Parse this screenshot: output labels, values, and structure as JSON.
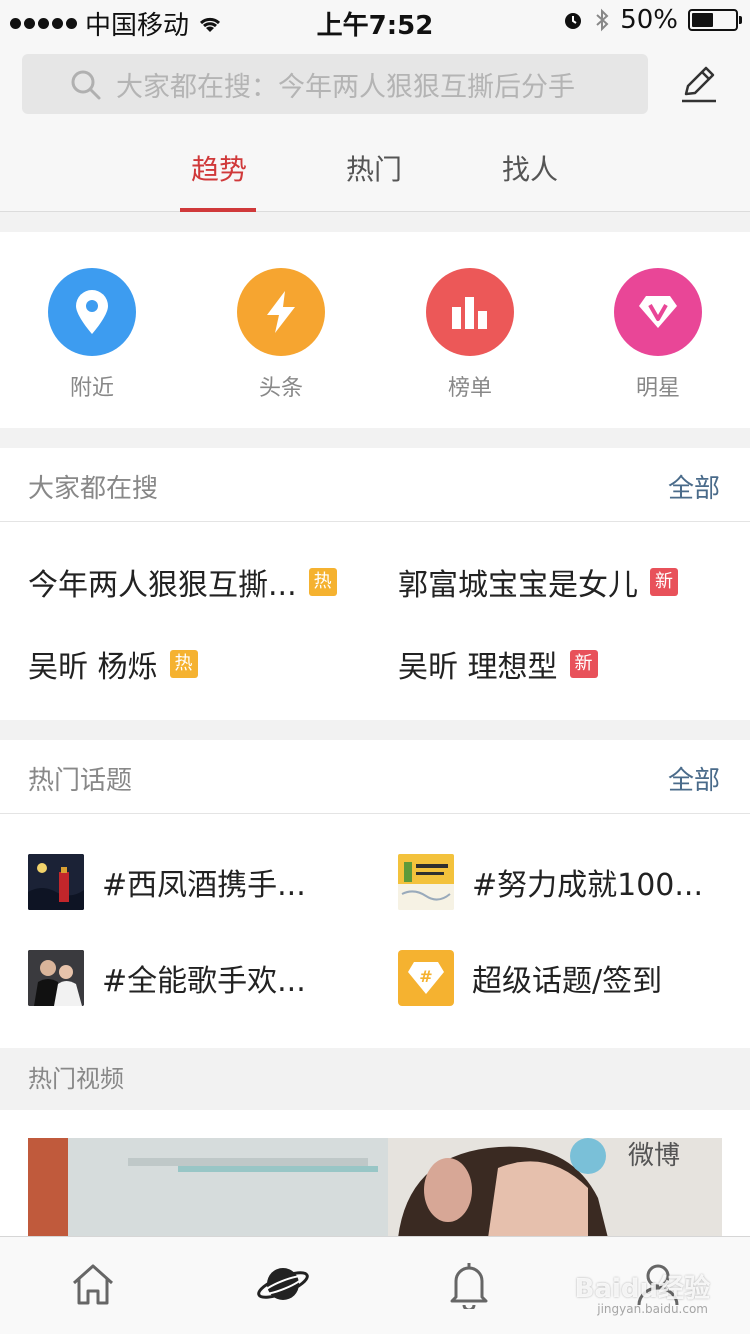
{
  "status_bar": {
    "carrier": "中国移动",
    "time": "上午7:52",
    "battery": "50%",
    "battery_level": 0.5
  },
  "search": {
    "placeholder": "大家都在搜：今年两人狠狠互撕后分手"
  },
  "tabs": [
    {
      "label": "趋势",
      "active": true
    },
    {
      "label": "热门",
      "active": false
    },
    {
      "label": "找人",
      "active": false
    }
  ],
  "quick_links": [
    {
      "label": "附近",
      "icon": "location-pin-icon",
      "color": "#3d9cf0"
    },
    {
      "label": "头条",
      "icon": "lightning-icon",
      "color": "#f6a530"
    },
    {
      "label": "榜单",
      "icon": "bar-chart-icon",
      "color": "#ec5858"
    },
    {
      "label": "明星",
      "icon": "diamond-v-icon",
      "color": "#e94697"
    }
  ],
  "trending_search": {
    "title": "大家都在搜",
    "all_label": "全部",
    "items": [
      {
        "text": "今年两人狠狠互撕...",
        "tag": "热",
        "tag_type": "hot"
      },
      {
        "text": "郭富城宝宝是女儿",
        "tag": "新",
        "tag_type": "new"
      },
      {
        "text": "吴昕 杨烁",
        "tag": "热",
        "tag_type": "hot"
      },
      {
        "text": "吴昕 理想型",
        "tag": "新",
        "tag_type": "new"
      }
    ]
  },
  "hot_topics": {
    "title": "热门话题",
    "all_label": "全部",
    "items": [
      {
        "text": "#西凤酒携手..."
      },
      {
        "text": "#努力成就100..."
      },
      {
        "text": "#全能歌手欢..."
      },
      {
        "text": "超级话题/签到"
      }
    ]
  },
  "hot_videos": {
    "title": "热门视频"
  },
  "bottom_nav": [
    {
      "icon": "home-icon",
      "active": false
    },
    {
      "icon": "discover-planet-icon",
      "active": true
    },
    {
      "icon": "bell-icon",
      "active": false
    },
    {
      "icon": "profile-icon",
      "active": false
    }
  ],
  "watermark": {
    "text": "Baidu经验",
    "sub": "jingyan.baidu.com"
  }
}
